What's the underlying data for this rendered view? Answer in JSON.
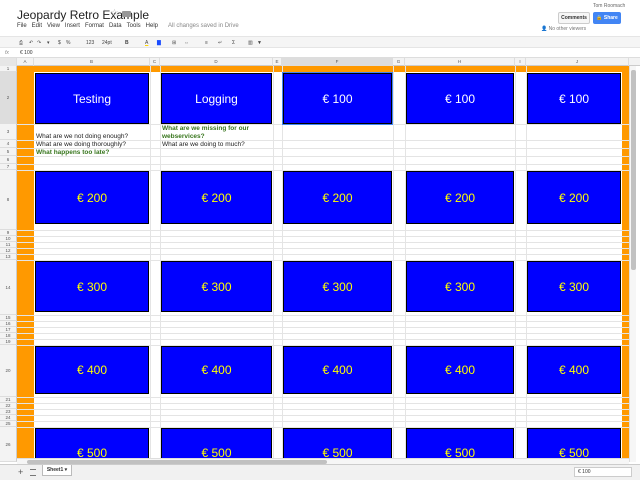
{
  "doc": {
    "title": "Jeopardy Retro Example",
    "save_status": "All changes saved in Drive",
    "user": "Tom Roomach",
    "comments_label": "Comments",
    "share_label": "Share",
    "viewers": "No other viewers",
    "menu": [
      "File",
      "Edit",
      "View",
      "Insert",
      "Format",
      "Data",
      "Tools",
      "Help"
    ]
  },
  "toolbar": {
    "number_format": "123",
    "font_size": "24pt",
    "bold": "B",
    "text_color": "A"
  },
  "formula": {
    "fx": "fx",
    "value": "€ 100"
  },
  "columns": [
    "A",
    "B",
    "C",
    "D",
    "E",
    "F",
    "G",
    "H",
    "I",
    "J"
  ],
  "rows": [
    "1",
    "2",
    "3",
    "4",
    "5",
    "6",
    "7",
    "8",
    "9",
    "10",
    "11",
    "12",
    "13",
    "14",
    "15",
    "16",
    "17",
    "18",
    "19",
    "20",
    "21",
    "22",
    "23",
    "24",
    "25",
    "26"
  ],
  "board": {
    "categories": [
      "Testing",
      "Logging",
      "€ 100",
      "€ 100",
      "€ 100"
    ],
    "row200": [
      "€ 200",
      "€ 200",
      "€ 200",
      "€ 200",
      "€ 200"
    ],
    "row300": [
      "€ 300",
      "€ 300",
      "€ 300",
      "€ 300",
      "€ 300"
    ],
    "row400": [
      "€ 400",
      "€ 400",
      "€ 400",
      "€ 400",
      "€ 400"
    ],
    "row500": [
      "€ 500",
      "€ 500",
      "€ 500",
      "€ 500",
      "€ 500"
    ]
  },
  "notes": {
    "b3": "What are we not doing enough?",
    "b4": "What are we doing thoroughly?",
    "b5": "What happens too late?",
    "d3a": "What are we missing for our",
    "d3b": "webservices?",
    "d4": "What are we doing to much?"
  },
  "sheet": {
    "tab_name": "Sheet1",
    "sum": "€ 100"
  },
  "colors": {
    "board_blue": "#0000ff",
    "value_yellow": "#ffff00",
    "frame_orange": "#ff9900",
    "note_green": "#38761d"
  }
}
